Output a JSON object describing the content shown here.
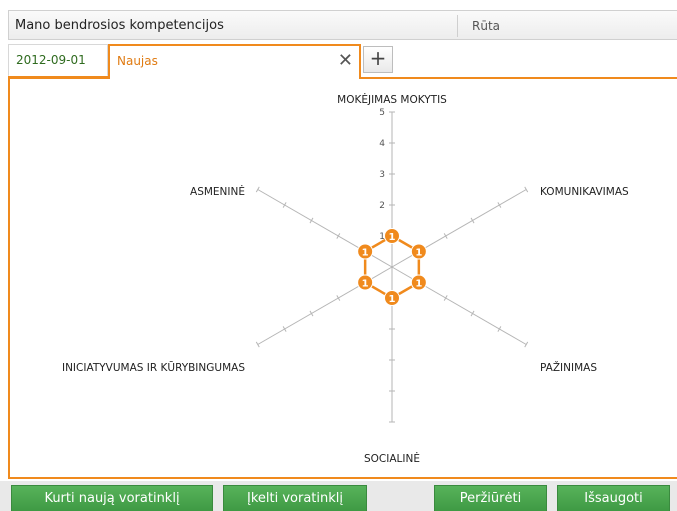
{
  "header": {
    "title": "Mano bendrosios kompetencijos",
    "user": "Rūta"
  },
  "tabs": [
    {
      "label": "2012-09-01"
    },
    {
      "label": "Naujas"
    }
  ],
  "tab_close_icon": "close-icon",
  "add_tab_label": "+",
  "chart_data": {
    "type": "radar",
    "axes": [
      "MOKĖJIMAS MOKYTIS",
      "KOMUNIKAVIMAS",
      "PAŽINIMAS",
      "SOCIALINĖ",
      "INICIATYVUMAS IR KŪRYBINGUMAS",
      "ASMENINĖ"
    ],
    "rlim": [
      0,
      5
    ],
    "ticks": [
      "1",
      "2",
      "3",
      "4",
      "5"
    ],
    "values": [
      1,
      1,
      1,
      1,
      1,
      1
    ],
    "point_labels": [
      "1",
      "1",
      "1",
      "1",
      "1",
      "1"
    ],
    "color": "#f08a1d"
  },
  "buttons": {
    "create": "Kurti naują voratinklį",
    "upload": "Įkelti voratinklį",
    "view": "Peržiūrėti",
    "save": "Išsaugoti"
  },
  "colors": {
    "accent": "#f08a1d",
    "button": "#4aa64e",
    "date_tab_text": "#2f6b1f"
  }
}
